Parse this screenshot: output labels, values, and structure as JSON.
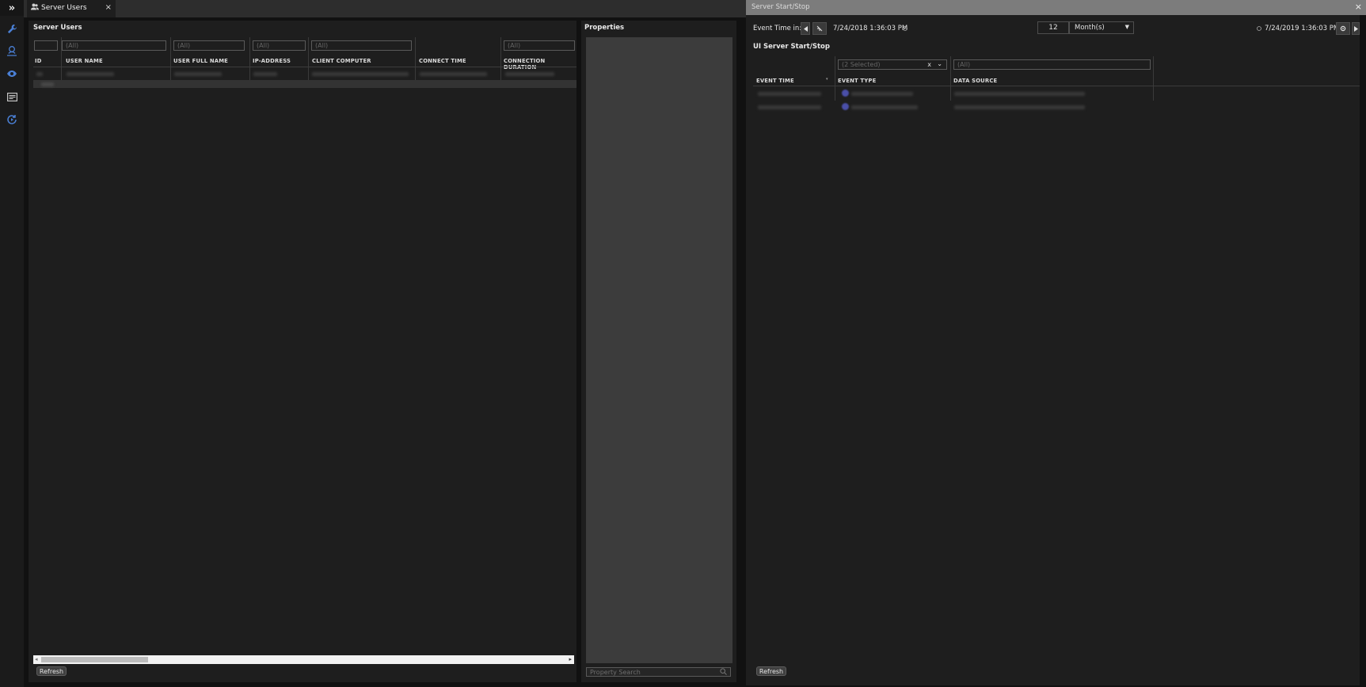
{
  "rail": {
    "expand_icon": "»",
    "items": [
      "wrench-icon",
      "user-network-icon",
      "eye-icon",
      "list-card-icon",
      "refresh-cycle-icon"
    ]
  },
  "tab": {
    "label": "Server Users",
    "close": "×"
  },
  "users": {
    "title": "Server Users",
    "filters": [
      "",
      "(All)",
      "(All)",
      "(All)",
      "(All)",
      "",
      "(All)"
    ],
    "columns": [
      "ID",
      "USER NAME",
      "USER FULL NAME",
      "IP-ADDRESS",
      "CLIENT COMPUTER",
      "CONNECT TIME",
      "CONNECTION DURATION"
    ],
    "refresh": "Refresh"
  },
  "properties": {
    "title": "Properties",
    "search_placeholder": "Property Search"
  },
  "startstop": {
    "window_title": "Server Start/Stop",
    "close": "×",
    "event_time_label": "Event Time in:",
    "start_time": "7/24/2018 1:36:03 PM",
    "count": "12",
    "unit": "Month(s)",
    "end_time": "7/24/2019 1:36:03 PM",
    "grid_title": "UI Server Start/Stop",
    "event_type_filter": "(2 Selected)",
    "event_type_clear": "x",
    "data_source_filter": "(All)",
    "columns": [
      "EVENT TIME",
      "EVENT TYPE",
      "DATA SOURCE"
    ],
    "refresh": "Refresh"
  },
  "colors": {
    "accent": "#4a7fd4",
    "background": "#1e1e1e",
    "title_bar": "#7c7c7c"
  }
}
